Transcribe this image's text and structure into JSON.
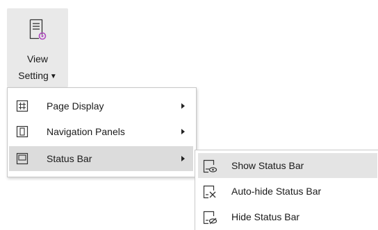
{
  "ribbon": {
    "button_line1": "View",
    "button_line2": "Setting",
    "icon": "view-setting-icon"
  },
  "menu": {
    "items": [
      {
        "label": "Page Display",
        "icon": "page-display-icon",
        "has_submenu": true
      },
      {
        "label": "Navigation Panels",
        "icon": "navigation-panels-icon",
        "has_submenu": true
      },
      {
        "label": "Status Bar",
        "icon": "status-bar-icon",
        "has_submenu": true,
        "active": true
      }
    ]
  },
  "submenu": {
    "items": [
      {
        "label": "Show Status Bar",
        "icon": "show-status-bar-icon",
        "active": true
      },
      {
        "label": "Auto-hide Status Bar",
        "icon": "auto-hide-status-bar-icon"
      },
      {
        "label": "Hide Status Bar",
        "icon": "hide-status-bar-icon"
      }
    ]
  },
  "colors": {
    "accent": "#b04ac0",
    "menu_highlight": "#dcdcdc",
    "ribbon_button_bg": "#e9e9e9"
  }
}
